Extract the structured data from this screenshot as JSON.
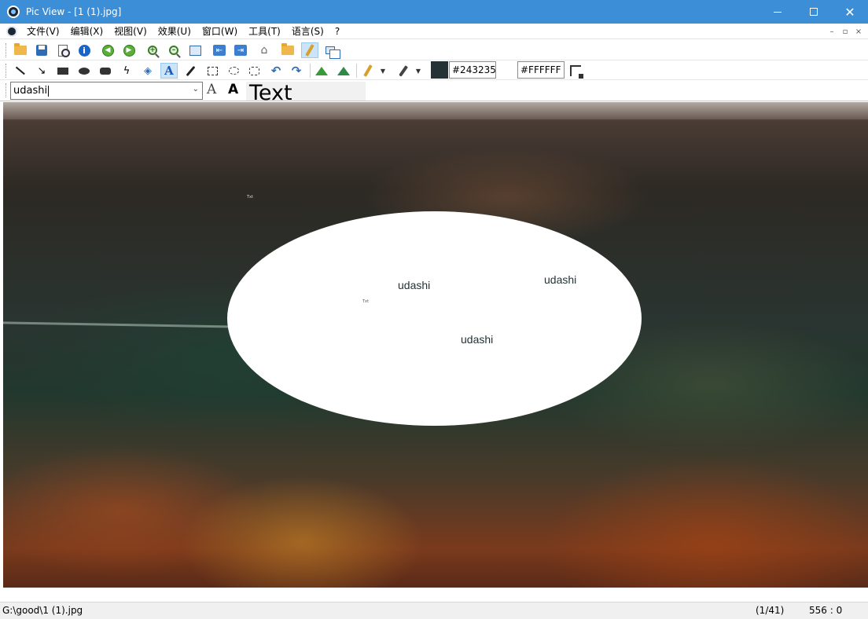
{
  "window": {
    "title": "Pic View - [1 (1).jpg]",
    "icon": "eye-app-icon",
    "controls": [
      "minimize-icon",
      "maximize-icon",
      "close-icon"
    ]
  },
  "menu": {
    "items": [
      "文件(V)",
      "编辑(X)",
      "视图(V)",
      "效果(U)",
      "窗口(W)",
      "工具(T)",
      "语言(S)",
      "?"
    ],
    "mdi_controls": [
      "–",
      "▫",
      "×"
    ]
  },
  "toolbar1": {
    "icons": [
      "open-folder-icon",
      "save-icon",
      "print-preview-icon",
      "info-icon",
      "prev-circle-icon",
      "next-circle-icon",
      "zoom-in-icon",
      "zoom-out-icon",
      "fit-icon",
      "prev-image-icon",
      "next-image-icon",
      "slideshow-icon",
      "browse-folder-icon",
      "pencil-edit-icon",
      "window-stack-icon"
    ]
  },
  "toolbar2": {
    "icons": [
      "line-icon",
      "arrow-line-icon",
      "rectangle-icon",
      "ellipse-icon",
      "rounded-rect-icon",
      "freehand-icon",
      "fill-icon",
      "text-tool-icon",
      "dropper-icon",
      "rect-select-icon",
      "ellipse-select-icon",
      "rrect-select-icon",
      "undo-icon",
      "redo-icon",
      "mountain-icon",
      "mountain-icon-2",
      "pen-icon",
      "brush-icon",
      "swap-colors-icon"
    ],
    "foreground_color": "#243235",
    "background_color": "#FFFFFF",
    "foreground_hex": "#243235",
    "background_hex": "#FFFFFF"
  },
  "toolbar3": {
    "font_value": "udashi",
    "text_preview": "Text"
  },
  "canvas": {
    "labels": [
      "udashi",
      "udashi",
      "udashi"
    ],
    "tiny_labels": [
      "Txt",
      "Txt"
    ]
  },
  "status": {
    "path": "G:\\good\\1 (1).jpg",
    "count": "(1/41)",
    "coords": "556 : 0"
  }
}
